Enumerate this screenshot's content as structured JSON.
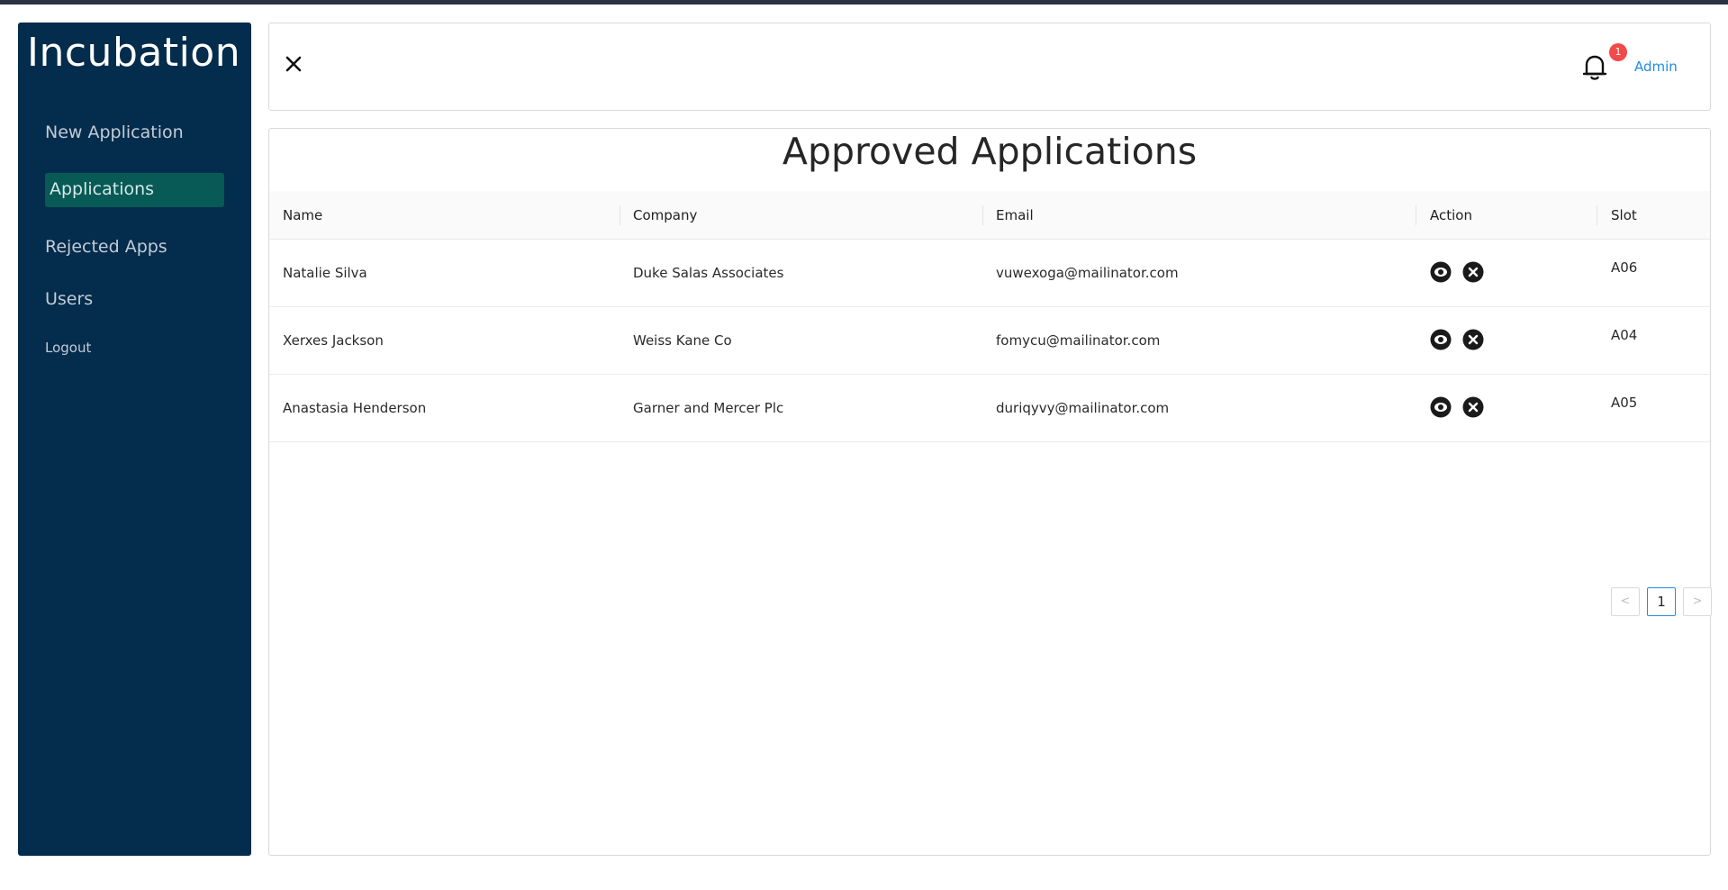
{
  "app": {
    "brand": "Incubation"
  },
  "sidebar": {
    "items": [
      {
        "label": "New Application",
        "active": false
      },
      {
        "label": "Applications",
        "active": true
      },
      {
        "label": "Rejected Apps",
        "active": false
      },
      {
        "label": "Users",
        "active": false
      },
      {
        "label": "Logout",
        "active": false
      }
    ]
  },
  "header": {
    "close_icon": "close-icon",
    "notification_count": "1",
    "user_label": "Admin"
  },
  "main": {
    "title": "Approved Applications",
    "columns": [
      "Name",
      "Company",
      "Email",
      "Action",
      "Slot"
    ],
    "rows": [
      {
        "name": "Natalie Silva",
        "company": "Duke Salas Associates",
        "email": "vuwexoga@mailinator.com",
        "slot": "A06"
      },
      {
        "name": "Xerxes Jackson",
        "company": "Weiss Kane Co",
        "email": "fomycu@mailinator.com",
        "slot": "A04"
      },
      {
        "name": "Anastasia Henderson",
        "company": "Garner and Mercer Plc",
        "email": "duriqyvy@mailinator.com",
        "slot": "A05"
      }
    ],
    "pagination": {
      "prev": "<",
      "current_page": "1",
      "next": ">"
    }
  },
  "colors": {
    "sidebar": "#042c4c",
    "active_item": "#075a55",
    "accent": "#1f8ce3",
    "badge": "#f04a4a"
  }
}
